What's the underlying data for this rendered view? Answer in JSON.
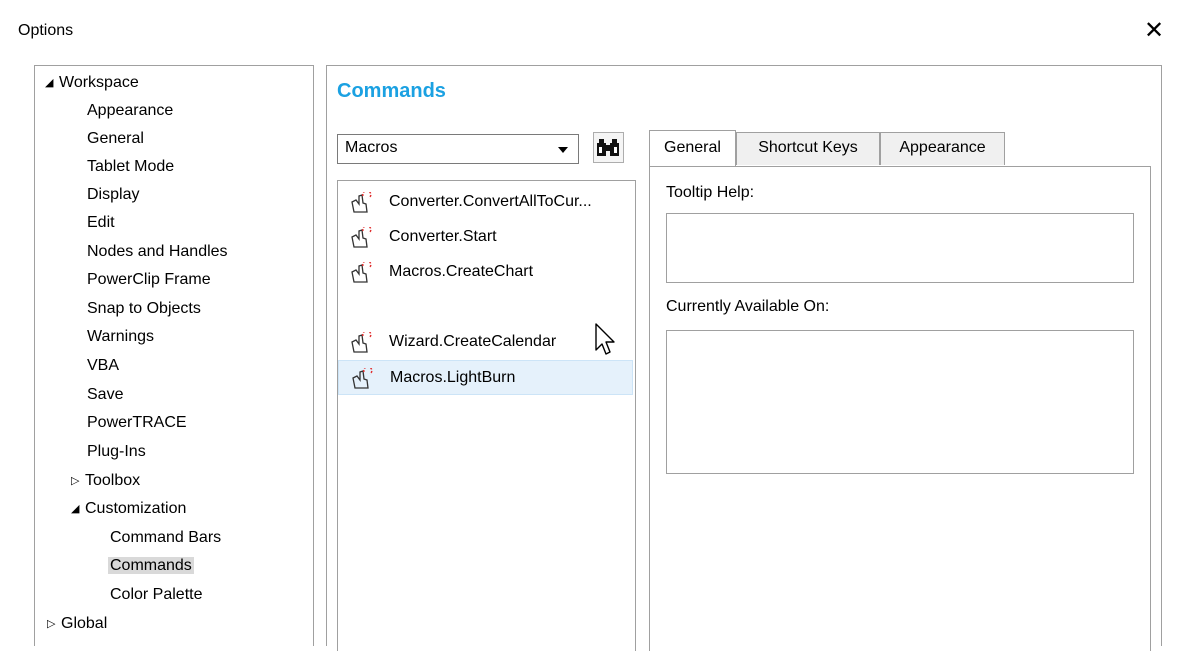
{
  "dialog": {
    "title": "Options",
    "close_glyph": "✕"
  },
  "tree": {
    "items": [
      {
        "label": "Workspace",
        "twisty": "◢"
      },
      {
        "label": "Appearance"
      },
      {
        "label": "General"
      },
      {
        "label": "Tablet Mode"
      },
      {
        "label": "Display"
      },
      {
        "label": "Edit"
      },
      {
        "label": "Nodes and Handles"
      },
      {
        "label": "PowerClip Frame"
      },
      {
        "label": "Snap to Objects"
      },
      {
        "label": "Warnings"
      },
      {
        "label": "VBA"
      },
      {
        "label": "Save"
      },
      {
        "label": "PowerTRACE"
      },
      {
        "label": "Plug-Ins"
      },
      {
        "label": "Toolbox",
        "twisty": "▷"
      },
      {
        "label": "Customization",
        "twisty": "◢"
      },
      {
        "label": "Command Bars"
      },
      {
        "label": "Commands",
        "selected": true
      },
      {
        "label": "Color Palette"
      },
      {
        "label": "Global",
        "twisty": "▷"
      }
    ]
  },
  "panel": {
    "title": "Commands",
    "category_select": {
      "value": "Macros"
    },
    "find_button_icon": "binoculars-icon",
    "commands": [
      {
        "label": "Converter.ConvertAllToCur..."
      },
      {
        "label": "Converter.Start"
      },
      {
        "label": "Macros.CreateChart"
      },
      {
        "label": "Macros.LightBurn",
        "highlighted": true
      },
      {
        "label": "Wizard.CreateCalendar"
      }
    ],
    "tabs": [
      {
        "label": "General",
        "active": true
      },
      {
        "label": "Shortcut Keys"
      },
      {
        "label": "Appearance"
      }
    ],
    "general": {
      "tooltip_label": "Tooltip Help:",
      "available_label": "Currently Available On:"
    }
  },
  "colors": {
    "accent": "#1ba1e2",
    "selection": "#d9d9d9",
    "hover": "#e5f1fb",
    "macro_icon_red": "#e03030"
  }
}
